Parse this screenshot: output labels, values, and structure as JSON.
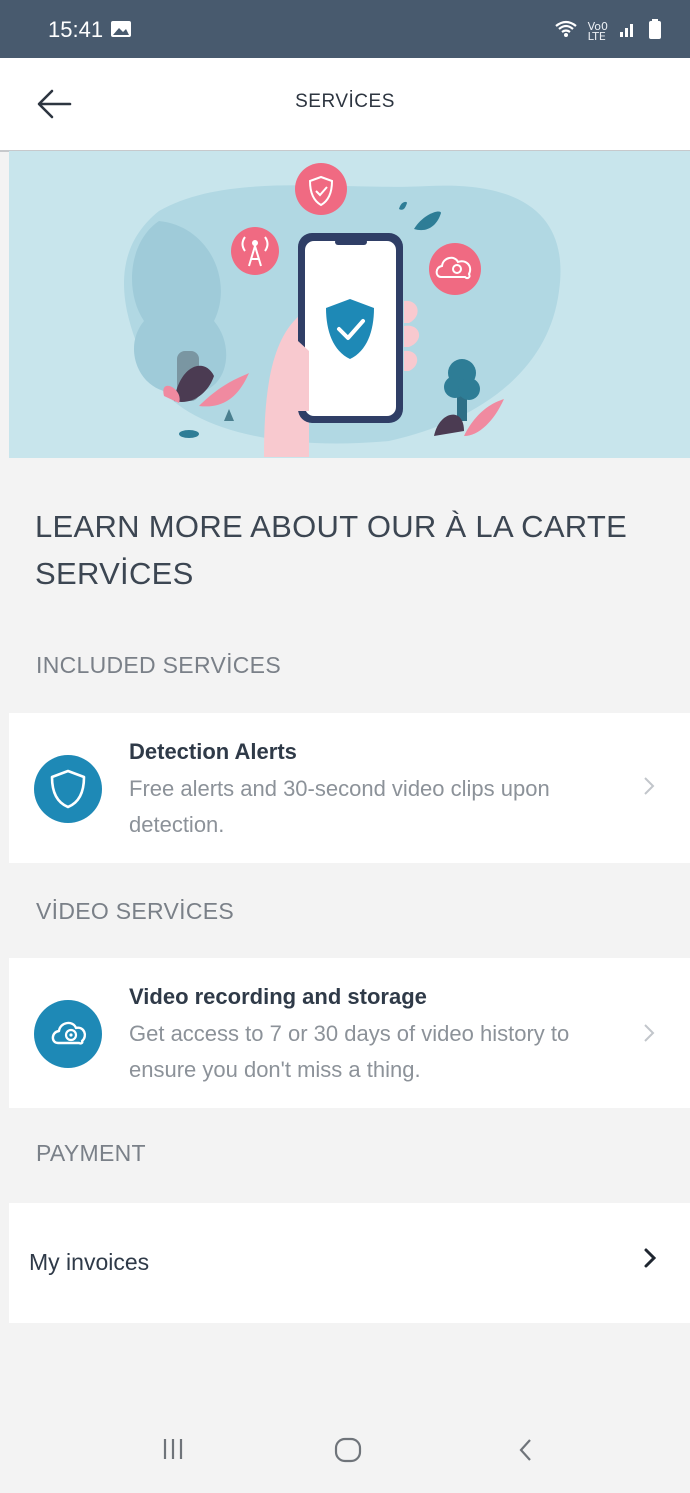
{
  "status_bar": {
    "time": "15:41",
    "network_label_top": "Vo0",
    "network_label_bottom": "LTE"
  },
  "app_bar": {
    "title": "SERVİCES"
  },
  "headline": "LEARN MORE ABOUT OUR À LA CARTE SERVİCES",
  "sections": {
    "included": {
      "label": "INCLUDED SERVİCES",
      "item": {
        "title": "Detection Alerts",
        "description": "Free alerts and 30-second video clips upon detection.",
        "icon": "shield-icon"
      }
    },
    "video": {
      "label": "VİDEO SERVİCES",
      "item": {
        "title": "Video recording and storage",
        "description": "Get access to 7 or 30 days of video history to ensure you don't miss a thing.",
        "icon": "cloud-camera-icon"
      }
    },
    "payment": {
      "label": "PAYMENT",
      "invoices_label": "My invoices"
    }
  },
  "colors": {
    "accent": "#1e89b6",
    "status_bar": "#485a6e",
    "hero_bg": "#c8e5ec",
    "pink": "#f06a82"
  }
}
